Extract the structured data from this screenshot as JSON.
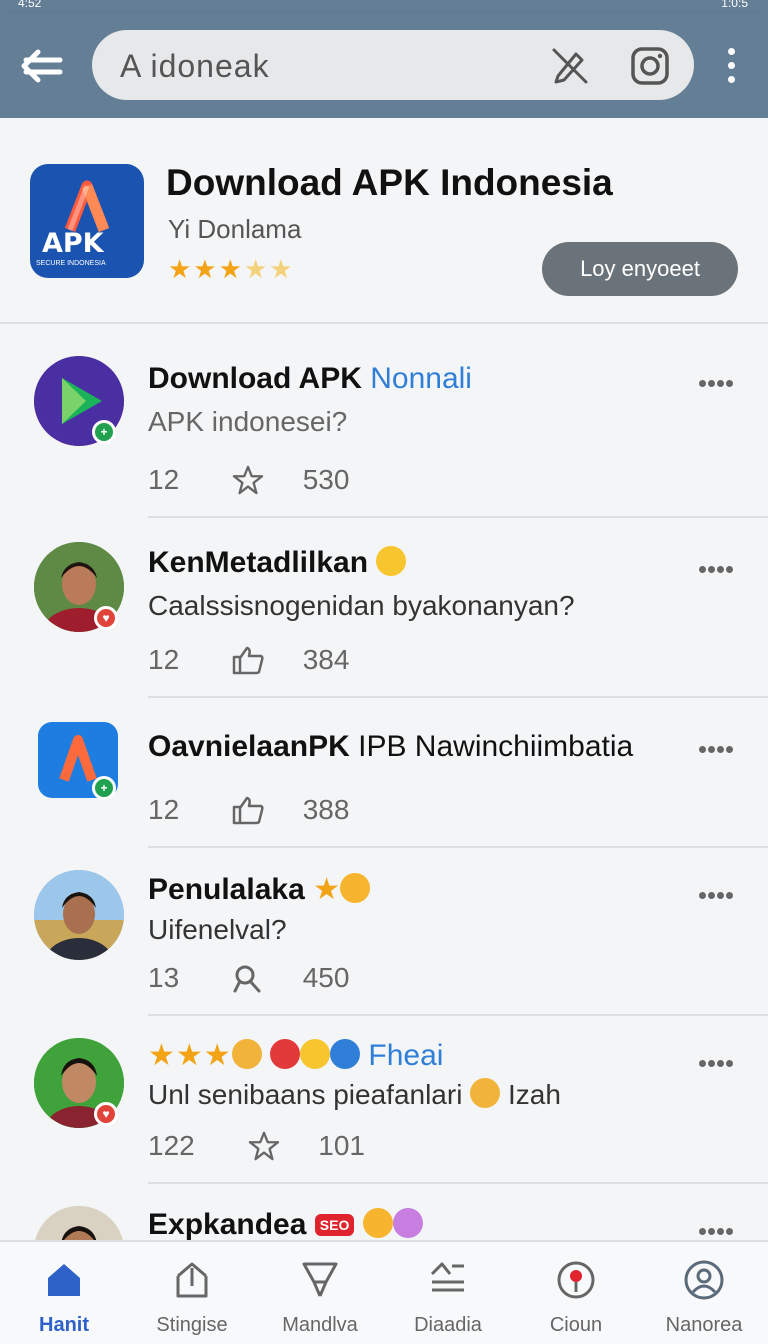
{
  "status_bar": {
    "left": "4:52",
    "right": "1:0:5"
  },
  "search": {
    "value": "A  idoneak"
  },
  "header": {
    "title": "Download APK Indonesia",
    "subtitle": "Yi Donlama",
    "stars": "★★★",
    "stars_dim": "★★",
    "button_label": "Loy enyoeet",
    "icon_text": "APK",
    "icon_subtext": "SECURE INDONESIA"
  },
  "feed": [
    {
      "name": "Download APK",
      "name_extra": "Nonnali",
      "message": "APK indonesei?",
      "count_a": "12",
      "count_b": "530",
      "icon": "star-icon"
    },
    {
      "name": "KenMetadlilkan",
      "message": "Caalssisnogenidan byakonanyan?",
      "count_a": "12",
      "count_b": "384",
      "icon": "thumb-icon"
    },
    {
      "name": "OavnielaanPK",
      "name_extra": "IPB Nawinchiimbatia",
      "count_a": "12",
      "count_b": "388",
      "icon": "thumb-icon"
    },
    {
      "name": "Penulalaka",
      "message": "Uifenelval?",
      "count_a": "13",
      "count_b": "450",
      "icon": "tool-icon"
    },
    {
      "name_extra": "Fheai",
      "message_a": "Unl senibaans pieafanlari",
      "message_b": "Izah",
      "count_a": "122",
      "count_b": "101",
      "icon": "star-icon"
    },
    {
      "name": "Expkandea",
      "badge_text": "SEO"
    }
  ],
  "nav": [
    {
      "label": "Hanit",
      "icon": "home-icon"
    },
    {
      "label": "Stingise",
      "icon": "upload-icon"
    },
    {
      "label": "Mandlva",
      "icon": "cart-icon"
    },
    {
      "label": "Diaadia",
      "icon": "shapes-icon"
    },
    {
      "label": "Cioun",
      "icon": "location-icon"
    },
    {
      "label": "Nanorea",
      "icon": "profile-icon"
    }
  ],
  "colors": {
    "appbar": "#647e95",
    "accent": "#2f62c9",
    "stars": "#f2a316",
    "link": "#2f7fd8"
  }
}
